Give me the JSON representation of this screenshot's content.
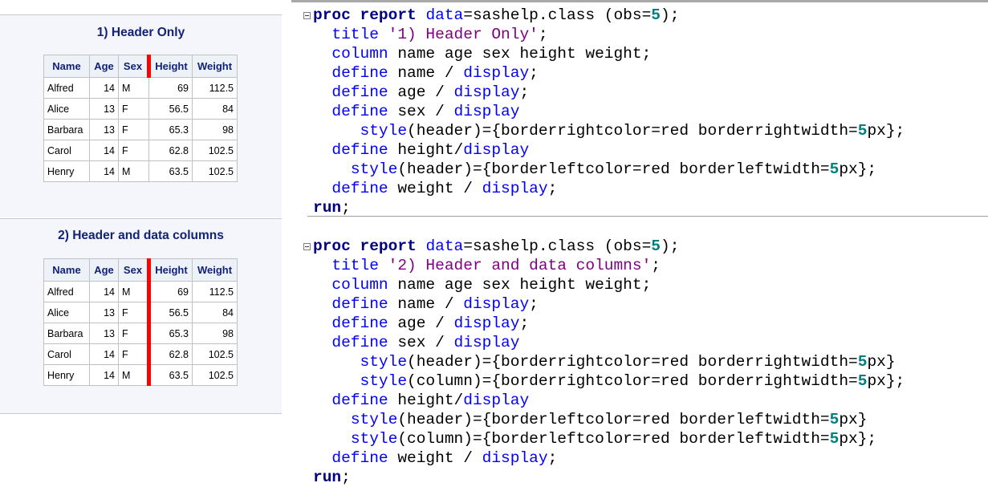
{
  "reports": [
    {
      "title": "1) Header Only",
      "columns": [
        "Name",
        "Age",
        "Sex",
        "Height",
        "Weight"
      ],
      "rows": [
        [
          "Alfred",
          "14",
          "M",
          "69",
          "112.5"
        ],
        [
          "Alice",
          "13",
          "F",
          "56.5",
          "84"
        ],
        [
          "Barbara",
          "13",
          "F",
          "65.3",
          "98"
        ],
        [
          "Carol",
          "14",
          "F",
          "62.8",
          "102.5"
        ],
        [
          "Henry",
          "14",
          "M",
          "63.5",
          "102.5"
        ]
      ],
      "red_border_scope": "header"
    },
    {
      "title": "2) Header and data columns",
      "columns": [
        "Name",
        "Age",
        "Sex",
        "Height",
        "Weight"
      ],
      "rows": [
        [
          "Alfred",
          "14",
          "M",
          "69",
          "112.5"
        ],
        [
          "Alice",
          "13",
          "F",
          "56.5",
          "84"
        ],
        [
          "Barbara",
          "13",
          "F",
          "65.3",
          "98"
        ],
        [
          "Carol",
          "14",
          "F",
          "62.8",
          "102.5"
        ],
        [
          "Henry",
          "14",
          "M",
          "63.5",
          "102.5"
        ]
      ],
      "red_border_scope": "header and columns"
    }
  ],
  "colors": {
    "keyword": "#000080",
    "blue": "#0000ff",
    "string": "#800080",
    "number": "#008080",
    "header_text": "#112277",
    "accent_border": "#ff0000"
  },
  "code_blocks": [
    {
      "lines": [
        [
          [
            "proc report",
            "kw"
          ],
          [
            " ",
            ""
          ],
          [
            "data",
            "bl"
          ],
          [
            "=sashelp.class (obs=",
            ""
          ],
          [
            "5",
            "nm"
          ],
          [
            ");",
            ""
          ]
        ],
        [
          [
            "  ",
            ""
          ],
          [
            "title",
            "bl"
          ],
          [
            " ",
            ""
          ],
          [
            "'1) Header Only'",
            "pu"
          ],
          [
            ";",
            ""
          ]
        ],
        [
          [
            "  ",
            ""
          ],
          [
            "column",
            "bl"
          ],
          [
            " name age sex height weight;",
            ""
          ]
        ],
        [
          [
            "  ",
            ""
          ],
          [
            "define",
            "bl"
          ],
          [
            " name / ",
            ""
          ],
          [
            "display",
            "bl"
          ],
          [
            ";",
            ""
          ]
        ],
        [
          [
            "  ",
            ""
          ],
          [
            "define",
            "bl"
          ],
          [
            " age / ",
            ""
          ],
          [
            "display",
            "bl"
          ],
          [
            ";",
            ""
          ]
        ],
        [
          [
            "  ",
            ""
          ],
          [
            "define",
            "bl"
          ],
          [
            " sex / ",
            ""
          ],
          [
            "display",
            "bl"
          ]
        ],
        [
          [
            "     ",
            ""
          ],
          [
            "style",
            "bl"
          ],
          [
            "(header)={borderrightcolor=red borderrightwidth=",
            ""
          ],
          [
            "5",
            "nm"
          ],
          [
            "px};",
            ""
          ]
        ],
        [
          [
            "  ",
            ""
          ],
          [
            "define",
            "bl"
          ],
          [
            " height/",
            ""
          ],
          [
            "display",
            "bl"
          ]
        ],
        [
          [
            "    ",
            ""
          ],
          [
            "style",
            "bl"
          ],
          [
            "(header)={borderleftcolor=red borderleftwidth=",
            ""
          ],
          [
            "5",
            "nm"
          ],
          [
            "px};",
            ""
          ]
        ],
        [
          [
            "  ",
            ""
          ],
          [
            "define",
            "bl"
          ],
          [
            " weight / ",
            ""
          ],
          [
            "display",
            "bl"
          ],
          [
            ";",
            ""
          ]
        ],
        [
          [
            "run",
            "kw"
          ],
          [
            ";",
            ""
          ]
        ]
      ]
    },
    {
      "lines": [
        [
          [
            "proc report",
            "kw"
          ],
          [
            " ",
            ""
          ],
          [
            "data",
            "bl"
          ],
          [
            "=sashelp.class (obs=",
            ""
          ],
          [
            "5",
            "nm"
          ],
          [
            ");",
            ""
          ]
        ],
        [
          [
            "  ",
            ""
          ],
          [
            "title",
            "bl"
          ],
          [
            " ",
            ""
          ],
          [
            "'2) Header and data columns'",
            "pu"
          ],
          [
            ";",
            ""
          ]
        ],
        [
          [
            "  ",
            ""
          ],
          [
            "column",
            "bl"
          ],
          [
            " name age sex height weight;",
            ""
          ]
        ],
        [
          [
            "  ",
            ""
          ],
          [
            "define",
            "bl"
          ],
          [
            " name / ",
            ""
          ],
          [
            "display",
            "bl"
          ],
          [
            ";",
            ""
          ]
        ],
        [
          [
            "  ",
            ""
          ],
          [
            "define",
            "bl"
          ],
          [
            " age / ",
            ""
          ],
          [
            "display",
            "bl"
          ],
          [
            ";",
            ""
          ]
        ],
        [
          [
            "  ",
            ""
          ],
          [
            "define",
            "bl"
          ],
          [
            " sex / ",
            ""
          ],
          [
            "display",
            "bl"
          ]
        ],
        [
          [
            "     ",
            ""
          ],
          [
            "style",
            "bl"
          ],
          [
            "(header)={borderrightcolor=red borderrightwidth=",
            ""
          ],
          [
            "5",
            "nm"
          ],
          [
            "px}",
            ""
          ]
        ],
        [
          [
            "     ",
            ""
          ],
          [
            "style",
            "bl"
          ],
          [
            "(column)={borderrightcolor=red borderrightwidth=",
            ""
          ],
          [
            "5",
            "nm"
          ],
          [
            "px};",
            ""
          ]
        ],
        [
          [
            "  ",
            ""
          ],
          [
            "define",
            "bl"
          ],
          [
            " height/",
            ""
          ],
          [
            "display",
            "bl"
          ]
        ],
        [
          [
            "    ",
            ""
          ],
          [
            "style",
            "bl"
          ],
          [
            "(header)={borderleftcolor=red borderleftwidth=",
            ""
          ],
          [
            "5",
            "nm"
          ],
          [
            "px}",
            ""
          ]
        ],
        [
          [
            "    ",
            ""
          ],
          [
            "style",
            "bl"
          ],
          [
            "(column)={borderleftcolor=red borderleftwidth=",
            ""
          ],
          [
            "5",
            "nm"
          ],
          [
            "px};",
            ""
          ]
        ],
        [
          [
            "  ",
            ""
          ],
          [
            "define",
            "bl"
          ],
          [
            " weight / ",
            ""
          ],
          [
            "display",
            "bl"
          ],
          [
            ";",
            ""
          ]
        ],
        [
          [
            "run",
            "kw"
          ],
          [
            ";",
            ""
          ]
        ]
      ]
    }
  ]
}
